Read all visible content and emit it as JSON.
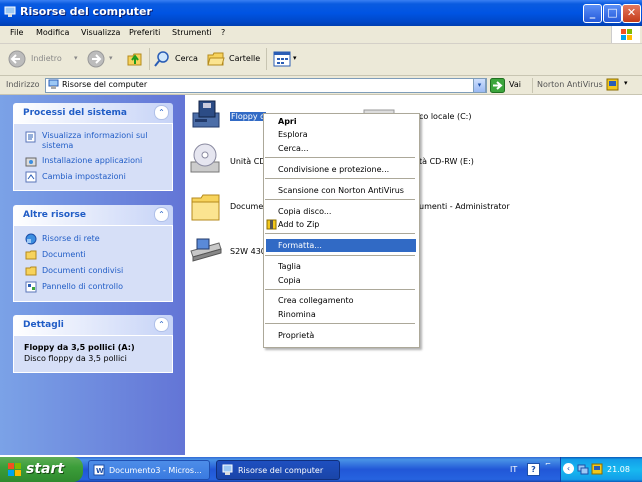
{
  "window": {
    "title": "Risorse del computer"
  },
  "menu": [
    "File",
    "Modifica",
    "Visualizza",
    "Preferiti",
    "Strumenti",
    "?"
  ],
  "toolbar": {
    "back_label": "Indietro",
    "search_label": "Cerca",
    "folders_label": "Cartelle"
  },
  "address": {
    "label": "Indirizzo",
    "value": "Risorse del computer",
    "go_label": "Vai",
    "norton_label": "Norton AntiVirus"
  },
  "panels": {
    "system": {
      "title": "Processi del sistema",
      "items": [
        "Visualizza informazioni sul sistema",
        "Installazione applicazioni",
        "Cambia impostazioni"
      ]
    },
    "other": {
      "title": "Altre risorse",
      "items": [
        "Risorse di rete",
        "Documenti",
        "Documenti condivisi",
        "Pannello di controllo"
      ]
    },
    "details": {
      "title": "Dettagli",
      "name": "Floppy da 3,5 pollici (A:)",
      "desc": "Disco floppy da 3,5 pollici"
    }
  },
  "drives": {
    "floppy": "Floppy d",
    "local": "co locale (C:)",
    "cd": "Unità CD",
    "cdrw": "tà CD-RW (E:)",
    "docs": "Documen",
    "docs_admin": "umenti - Administrator",
    "scanner": "S2W 430"
  },
  "context_menu": {
    "items": [
      {
        "label": "Apri",
        "bold": true
      },
      {
        "label": "Esplora"
      },
      {
        "label": "Cerca..."
      },
      {
        "label": "Condivisione e protezione..."
      },
      {
        "label": "Scansione con Norton AntiVirus"
      },
      {
        "label": "Copia disco..."
      },
      {
        "label": "Add to Zip"
      },
      {
        "label": "Formatta...",
        "highlighted": true
      },
      {
        "label": "Taglia"
      },
      {
        "label": "Copia"
      },
      {
        "label": "Crea collegamento"
      },
      {
        "label": "Rinomina"
      },
      {
        "label": "Proprietà"
      }
    ]
  },
  "taskbar": {
    "start_label": "start",
    "tasks": [
      "Documento3 - Micros...",
      "Risorse del computer"
    ],
    "lang": "IT",
    "clock": "21.08"
  },
  "colors": {
    "titlebar": "#0054e3",
    "highlight": "#316ac5",
    "panel_link": "#215dc6"
  }
}
